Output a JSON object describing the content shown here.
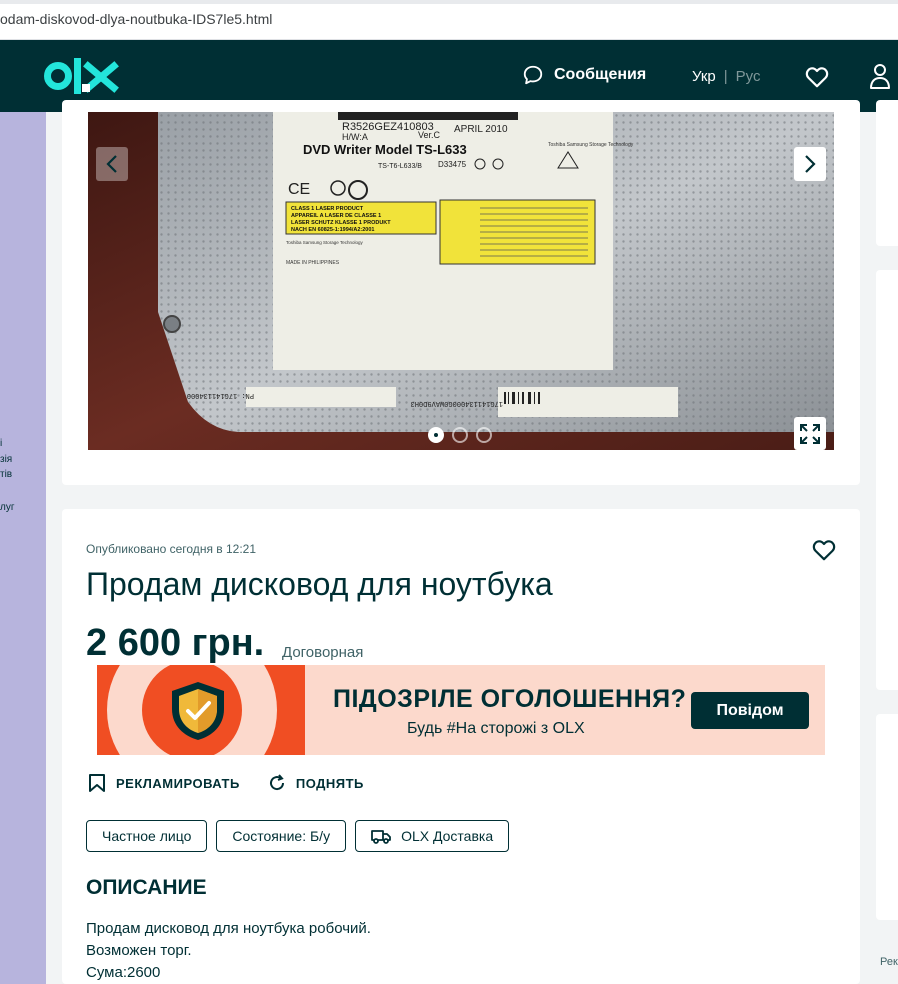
{
  "browser": {
    "url": "odam-diskovod-dlya-noutbuka-IDS7le5.html"
  },
  "header": {
    "messages_label": "Сообщения",
    "lang_ukr": "Укр",
    "lang_sep": "|",
    "lang_rus": "Рус"
  },
  "left_sidebar": {
    "lines": [
      "і",
      "зія",
      "тів",
      "луг"
    ]
  },
  "right_sidebar": {
    "text": "Рек"
  },
  "gallery": {
    "image_count": 3,
    "active_index": 0,
    "photo_text": {
      "model": "DVD Writer Model TS-L633",
      "serial": "R3526GEZ410803",
      "hw": "H/W:A",
      "ver": "Ver.C",
      "date": "APRIL 2010",
      "part": "TS-T6-L633/B",
      "code": "D33475",
      "laser1": "CLASS 1 LASER PRODUCT",
      "laser2": "APPAREIL A LASER DE CLASSE 1",
      "laser3": "LASER SCHUTZ KLASSE 1 PRODUKT",
      "laser4": "NACH EN 60825-1:1994/A2:2001",
      "maker": "Toshiba Samsung Storage Technology",
      "origin": "MADE IN PHILIPPINES",
      "barcode1": "PN: 17G141134000",
      "barcode2": "CH1040",
      "barcode3": "17G141134000G0WAV9D0H3"
    }
  },
  "listing": {
    "published": "Опубликовано сегодня в 12:21",
    "title": "Продам дисковод для ноутбука",
    "price": "2 600 грн.",
    "negotiable": "Договорная"
  },
  "banner": {
    "headline": "ПІДОЗРІЛЕ ОГОЛОШЕННЯ?",
    "subline": "Будь #На сторожі з OLX",
    "button": "Повідом"
  },
  "actions": {
    "promote": "РЕКЛАМИРОВАТЬ",
    "raise": "ПОДНЯТЬ"
  },
  "tags": {
    "seller": "Частное лицо",
    "condition": "Состояние: Б/у",
    "delivery": "OLX Доставка"
  },
  "description": {
    "heading": "ОПИСАНИЕ",
    "line1": "Продам дисковод для ноутбука робочий.",
    "line2": "Возможен торг.",
    "line3": "Сума:2600"
  },
  "colors": {
    "brand_dark": "#002f34",
    "brand_teal": "#23e5db",
    "banner_orange": "#f04e23",
    "banner_bg": "#fcd9cc",
    "sidebar_purple": "#b7b4dd"
  }
}
